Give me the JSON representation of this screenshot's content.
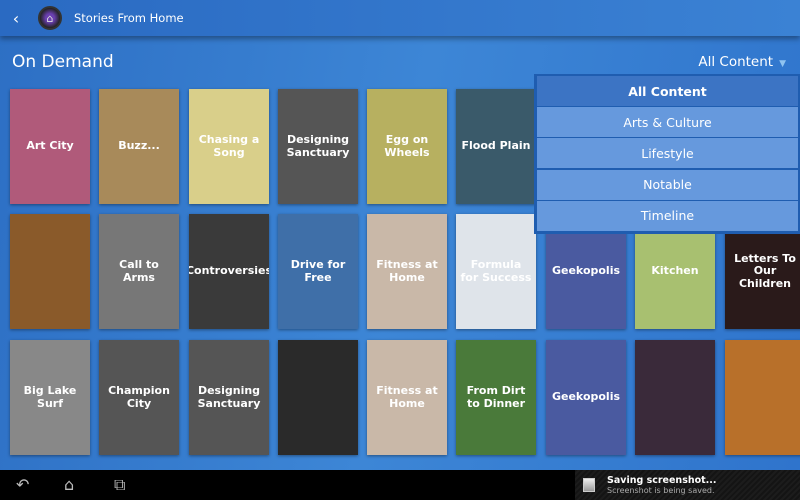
{
  "actionbar": {
    "title": "Stories From Home",
    "back_icon": "back-chevron-icon",
    "logo_icon": "house-logo-icon"
  },
  "page": {
    "heading": "On Demand"
  },
  "filter": {
    "selected": "All Content",
    "options": [
      "All Content",
      "Arts & Culture",
      "Lifestyle",
      "Notable",
      "Timeline"
    ]
  },
  "posters": [
    {
      "title": "Art City",
      "color": "#b05a7a"
    },
    {
      "title": "Buzz...",
      "color": "#a88a5a"
    },
    {
      "title": "Chasing a Song",
      "color": "#d9cf8a"
    },
    {
      "title": "Designing Sanctuary",
      "color": "#555"
    },
    {
      "title": "Egg on Wheels",
      "color": "#b7b060"
    },
    {
      "title": "Flood Plain",
      "color": "#3a5a6a"
    },
    {
      "title": "",
      "color": "#333"
    },
    {
      "title": "",
      "color": "#333"
    },
    {
      "title": "",
      "color": "#333"
    },
    {
      "title": "",
      "color": "#8a5a2a"
    },
    {
      "title": "Call to Arms",
      "color": "#777"
    },
    {
      "title": "Controversies",
      "color": "#3a3a3a"
    },
    {
      "title": "Drive for Free",
      "color": "#3f6fa8"
    },
    {
      "title": "Fitness at Home",
      "color": "#c9b8a8"
    },
    {
      "title": "Formula for Success",
      "color": "#dfe4ea"
    },
    {
      "title": "Geekopolis",
      "color": "#4a5aa0"
    },
    {
      "title": "Kitchen",
      "color": "#a8c070"
    },
    {
      "title": "Letters To Our Children",
      "color": "#2a1a1a"
    },
    {
      "title": "Big Lake Surf",
      "color": "#888"
    },
    {
      "title": "Champion City",
      "color": "#555"
    },
    {
      "title": "Designing Sanctuary",
      "color": "#555"
    },
    {
      "title": "",
      "color": "#2a2a2a"
    },
    {
      "title": "Fitness at Home",
      "color": "#c9b8a8"
    },
    {
      "title": "From Dirt to Dinner",
      "color": "#4a7a3a"
    },
    {
      "title": "Geekopolis",
      "color": "#4a5aa0"
    },
    {
      "title": "",
      "color": "#3a2a3a"
    },
    {
      "title": "",
      "color": "#b8702a"
    }
  ],
  "notification": {
    "title": "Saving screenshot...",
    "subtitle": "Screenshot is being saved."
  }
}
